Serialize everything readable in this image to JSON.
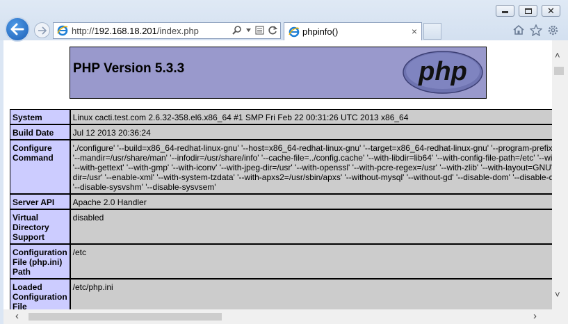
{
  "browser": {
    "url_prefix": "http://",
    "url_host": "192.168.18.201",
    "url_path": "/index.php",
    "tab_title": "phpinfo()",
    "tab_close": "×",
    "window_close": "✕"
  },
  "page": {
    "heading": "PHP Version 5.3.3",
    "logo_text": "php",
    "rows": [
      {
        "label": "System",
        "value": "Linux cacti.test.com 2.6.32-358.el6.x86_64 #1 SMP Fri Feb 22 00:31:26 UTC 2013 x86_64"
      },
      {
        "label": "Build Date",
        "value": "Jul 12 2013 20:36:24"
      },
      {
        "label": "Configure Command",
        "lines": [
          "'./configure' '--build=x86_64-redhat-linux-gnu' '--host=x86_64-redhat-linux-gnu' '--target=x86_64-redhat-linux-gnu' '--program-prefix",
          "'--mandir=/usr/share/man' '--infodir=/usr/share/info' '--cache-file=../config.cache' '--with-libdir=lib64' '--with-config-file-path=/etc' '--wi",
          "'--with-gettext' '--with-gmp' '--with-iconv' '--with-jpeg-dir=/usr' '--with-openssl' '--with-pcre-regex=/usr' '--with-zlib' '--with-layout=GNU'",
          "dir=/usr' '--enable-xml' '--with-system-tzdata' '--with-apxs2=/usr/sbin/apxs' '--without-mysql' '--without-gd' '--disable-dom' '--disable-d",
          "'--disable-sysvshm' '--disable-sysvsem'"
        ]
      },
      {
        "label": "Server API",
        "value": "Apache 2.0 Handler"
      },
      {
        "label": "Virtual Directory Support",
        "value": "disabled"
      },
      {
        "label": "Configuration File (php.ini) Path",
        "value": "/etc"
      },
      {
        "label": "Loaded Configuration File",
        "value": "/etc/php.ini"
      }
    ]
  },
  "colors": {
    "header_bg": "#9999cc",
    "label_bg": "#ccccff",
    "value_bg": "#cccccc",
    "back_button": "#1d5fb5"
  },
  "icons": [
    "back-arrow-icon",
    "forward-arrow-icon",
    "ie-icon",
    "search-icon",
    "dropdown-icon",
    "compat-view-icon",
    "refresh-icon",
    "home-icon",
    "star-icon",
    "gear-icon",
    "php-logo"
  ]
}
